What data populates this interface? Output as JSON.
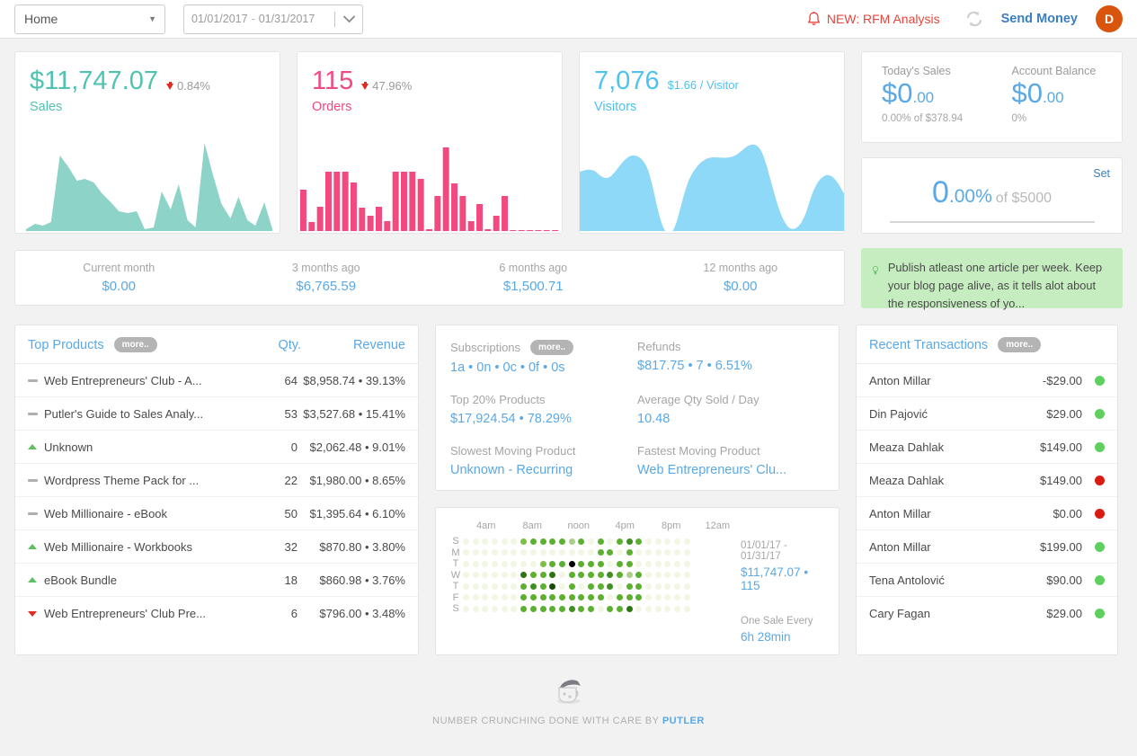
{
  "header": {
    "site_selector": "Home",
    "date_from": "01/01/2017",
    "date_sep": "-",
    "date_to": "01/31/2017",
    "notification": "NEW: RFM Analysis",
    "send_money": "Send Money",
    "avatar_initial": "D"
  },
  "kpis": [
    {
      "value": "$11,747.07",
      "delta": "0.84%",
      "label": "Sales",
      "color": "#4fc3b2"
    },
    {
      "value": "115",
      "delta": "47.96%",
      "label": "Orders",
      "color": "#f2497f"
    },
    {
      "value": "7,076",
      "delta": "$1.66 / Visitor",
      "label": "Visitors",
      "color": "#4ec3f0"
    }
  ],
  "months": [
    {
      "label": "Current month",
      "value": "$0.00"
    },
    {
      "label": "3 months ago",
      "value": "$6,765.59"
    },
    {
      "label": "6 months ago",
      "value": "$1,500.71"
    },
    {
      "label": "12 months ago",
      "value": "$0.00"
    }
  ],
  "side_stats": [
    {
      "label": "Today's Sales",
      "big": "$0",
      "small": ".00",
      "sub": "0.00% of $378.94"
    },
    {
      "label": "Account Balance",
      "big": "$0",
      "small": ".00",
      "sub": "0%"
    }
  ],
  "goal": {
    "set_label": "Set",
    "big": "0",
    "small": ".00%",
    "of": "of $5000"
  },
  "tip": {
    "text": "Publish atleast one article per week. Keep your blog page alive, as it tells alot about the responsiveness of yo..."
  },
  "products_panel": {
    "title": "Top Products",
    "more": "more..",
    "col_qty": "Qty.",
    "col_revenue": "Revenue",
    "rows": [
      {
        "trend": "flat",
        "name": "Web Entrepreneurs' Club - A...",
        "qty": "64",
        "revenue": "$8,958.74 • 39.13%"
      },
      {
        "trend": "flat",
        "name": "Putler's Guide to Sales Analy...",
        "qty": "53",
        "revenue": "$3,527.68 • 15.41%"
      },
      {
        "trend": "up",
        "name": "Unknown",
        "qty": "0",
        "revenue": "$2,062.48 • 9.01%"
      },
      {
        "trend": "flat",
        "name": "Wordpress Theme Pack for ...",
        "qty": "22",
        "revenue": "$1,980.00 • 8.65%"
      },
      {
        "trend": "flat",
        "name": "Web Millionaire - eBook",
        "qty": "50",
        "revenue": "$1,395.64 • 6.10%"
      },
      {
        "trend": "up",
        "name": "Web Millionaire - Workbooks",
        "qty": "32",
        "revenue": "$870.80 • 3.80%"
      },
      {
        "trend": "up",
        "name": "eBook Bundle",
        "qty": "18",
        "revenue": "$860.98 • 3.76%"
      },
      {
        "trend": "down",
        "name": "Web Entrepreneurs' Club Pre...",
        "qty": "6",
        "revenue": "$796.00 • 3.48%"
      }
    ]
  },
  "mid_stats": [
    {
      "label": "Subscriptions",
      "more": "more..",
      "value": "1a • 0n • 0c • 0f • 0s"
    },
    {
      "label": "Refunds",
      "value": "$817.75 • 7 • 6.51%"
    },
    {
      "label": "Top 20% Products",
      "value": "$17,924.54 • 78.29%"
    },
    {
      "label": "Average Qty Sold / Day",
      "value": "10.48"
    },
    {
      "label": "Slowest Moving Product",
      "value": "Unknown - Recurring"
    },
    {
      "label": "Fastest Moving Product",
      "value": "Web Entrepreneurs' Clu..."
    }
  ],
  "transactions_panel": {
    "title": "Recent Transactions",
    "more": "more..",
    "rows": [
      {
        "name": "Anton Millar",
        "amount": "-$29.00",
        "status": "#5fd05f"
      },
      {
        "name": "Din Pajović",
        "amount": "$29.00",
        "status": "#5fd05f"
      },
      {
        "name": "Meaza Dahlak",
        "amount": "$149.00",
        "status": "#5fd05f"
      },
      {
        "name": "Meaza Dahlak",
        "amount": "$149.00",
        "status": "#d91b10"
      },
      {
        "name": "Anton Millar",
        "amount": "$0.00",
        "status": "#d91b10"
      },
      {
        "name": "Anton Millar",
        "amount": "$199.00",
        "status": "#5fd05f"
      },
      {
        "name": "Tena Antolović",
        "amount": "$90.00",
        "status": "#5fd05f"
      },
      {
        "name": "Cary Fagan",
        "amount": "$29.00",
        "status": "#5fd05f"
      }
    ]
  },
  "heatmap_panel": {
    "date_range": "01/01/17 - 01/31/17",
    "totals": "$11,747.07 • 115",
    "cadence_label": "One Sale Every",
    "cadence_value": "6h 28min"
  },
  "footer": {
    "text": "NUMBER CRUNCHING DONE WITH CARE BY ",
    "brand": "PUTLER"
  },
  "chart_data": [
    {
      "type": "area",
      "title": "Sales",
      "color": "#8dd3c7",
      "ylabel": "Sales ($)",
      "x": [
        1,
        2,
        3,
        4,
        5,
        6,
        7,
        8,
        9,
        10,
        11,
        12,
        13,
        14,
        15,
        16,
        17,
        18,
        19,
        20,
        21,
        22,
        23,
        24,
        25,
        26,
        27,
        28,
        29,
        30,
        31
      ],
      "values": [
        2,
        6,
        78,
        62,
        58,
        60,
        52,
        40,
        26,
        22,
        20,
        22,
        4,
        2,
        44,
        64,
        36,
        66,
        40,
        8,
        2,
        6,
        96,
        48,
        24,
        10,
        34,
        6,
        4,
        30,
        2
      ]
    },
    {
      "type": "bar",
      "title": "Orders",
      "color": "#f2497f",
      "ylabel": "Orders",
      "categories": [
        1,
        2,
        3,
        4,
        5,
        6,
        7,
        8,
        9,
        10,
        11,
        12,
        13,
        14,
        15,
        16,
        17,
        18,
        19,
        20,
        21,
        22,
        23,
        24,
        25,
        26,
        27,
        28,
        29,
        30,
        31
      ],
      "values": [
        45,
        9,
        27,
        66,
        66,
        66,
        54,
        26,
        17,
        27,
        11,
        66,
        66,
        66,
        58,
        2,
        39,
        93,
        53,
        39,
        11,
        30,
        2,
        17,
        39,
        1,
        1,
        1,
        1,
        1,
        1
      ]
    },
    {
      "type": "area",
      "title": "Visitors",
      "color": "#8ed8f8",
      "ylabel": "Visitors",
      "x": [
        1,
        2,
        3,
        4,
        5,
        6,
        7,
        8,
        9,
        10,
        11,
        12,
        13,
        14,
        15,
        16,
        17,
        18,
        19,
        20,
        21,
        22,
        23,
        24,
        25,
        26,
        27,
        28,
        29,
        30,
        31
      ],
      "values": [
        60,
        68,
        60,
        74,
        80,
        76,
        52,
        20,
        2,
        4,
        36,
        66,
        70,
        70,
        72,
        78,
        88,
        84,
        74,
        56,
        36,
        14,
        6,
        18,
        44,
        56,
        48,
        40,
        44,
        52,
        40
      ]
    },
    {
      "type": "heatmap",
      "title": "Sales by hour and weekday",
      "xlabels": [
        "4am",
        "8am",
        "noon",
        "4pm",
        "8pm",
        "12am"
      ],
      "ylabels": [
        "S",
        "M",
        "T",
        "W",
        "T",
        "F",
        "S"
      ],
      "hours": 24,
      "scale": [
        "#f2f7e4",
        "#eef5d8",
        "#a9d08a",
        "#7cc043",
        "#5cb030",
        "#3f8f22",
        "#2e7512",
        "#1a4a08",
        "#000000"
      ],
      "values": [
        [
          0,
          0,
          0,
          0,
          0,
          0,
          3,
          4,
          4,
          4,
          4,
          2,
          4,
          0,
          4,
          0,
          4,
          5,
          4,
          0,
          0,
          0,
          0,
          0
        ],
        [
          0,
          0,
          0,
          0,
          0,
          0,
          0,
          0,
          0,
          0,
          0,
          0,
          0,
          0,
          4,
          4,
          0,
          4,
          0,
          0,
          0,
          0,
          0,
          0
        ],
        [
          0,
          0,
          0,
          0,
          0,
          0,
          0,
          0,
          3,
          4,
          4,
          8,
          4,
          4,
          4,
          0,
          4,
          4,
          0,
          0,
          0,
          0,
          0,
          0
        ],
        [
          0,
          0,
          0,
          0,
          0,
          0,
          6,
          4,
          4,
          6,
          0,
          4,
          4,
          4,
          4,
          5,
          4,
          2,
          4,
          0,
          0,
          0,
          0,
          0
        ],
        [
          0,
          0,
          0,
          0,
          0,
          0,
          4,
          5,
          4,
          7,
          0,
          4,
          0,
          4,
          4,
          5,
          0,
          4,
          4,
          0,
          0,
          0,
          0,
          0
        ],
        [
          0,
          0,
          0,
          0,
          0,
          0,
          4,
          4,
          4,
          4,
          4,
          4,
          4,
          4,
          4,
          0,
          4,
          4,
          4,
          0,
          0,
          0,
          0,
          0
        ],
        [
          0,
          0,
          0,
          0,
          0,
          0,
          4,
          4,
          4,
          4,
          4,
          5,
          4,
          4,
          0,
          4,
          4,
          6,
          0,
          0,
          0,
          0,
          0,
          0
        ]
      ]
    }
  ]
}
